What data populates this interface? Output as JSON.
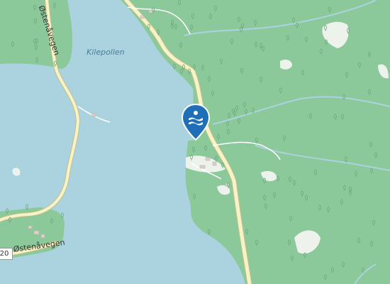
{
  "map": {
    "water_label": "Kilepollen",
    "road_labels": [
      "Østenåvegen",
      "Østenåvegen",
      "gen"
    ],
    "road_number": "20",
    "marker": {
      "icon": "swimming-icon",
      "type": "bathing-place",
      "color": "#1f6fb8"
    },
    "colors": {
      "forest": "#7fbf8a",
      "water": "#aad3df",
      "road": "#f7f3c9",
      "road_border": "#c9bd86",
      "clearing": "#f1f3ef"
    }
  }
}
